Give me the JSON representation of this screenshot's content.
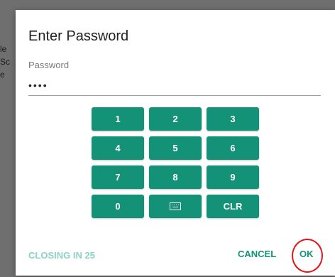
{
  "backdrop": {
    "fragments": [
      "le",
      "Sc",
      "e"
    ]
  },
  "dialog": {
    "title": "Enter Password",
    "password_label": "Password",
    "password_value": "••••",
    "keypad": [
      "1",
      "2",
      "3",
      "4",
      "5",
      "6",
      "7",
      "8",
      "9",
      "0",
      "keyboard-icon",
      "CLR"
    ],
    "countdown": "CLOSING IN 25",
    "cancel_label": "CANCEL",
    "ok_label": "OK"
  },
  "colors": {
    "accent": "#139278",
    "countdown": "#8cd3c3",
    "highlight_ring": "#e0161b"
  }
}
